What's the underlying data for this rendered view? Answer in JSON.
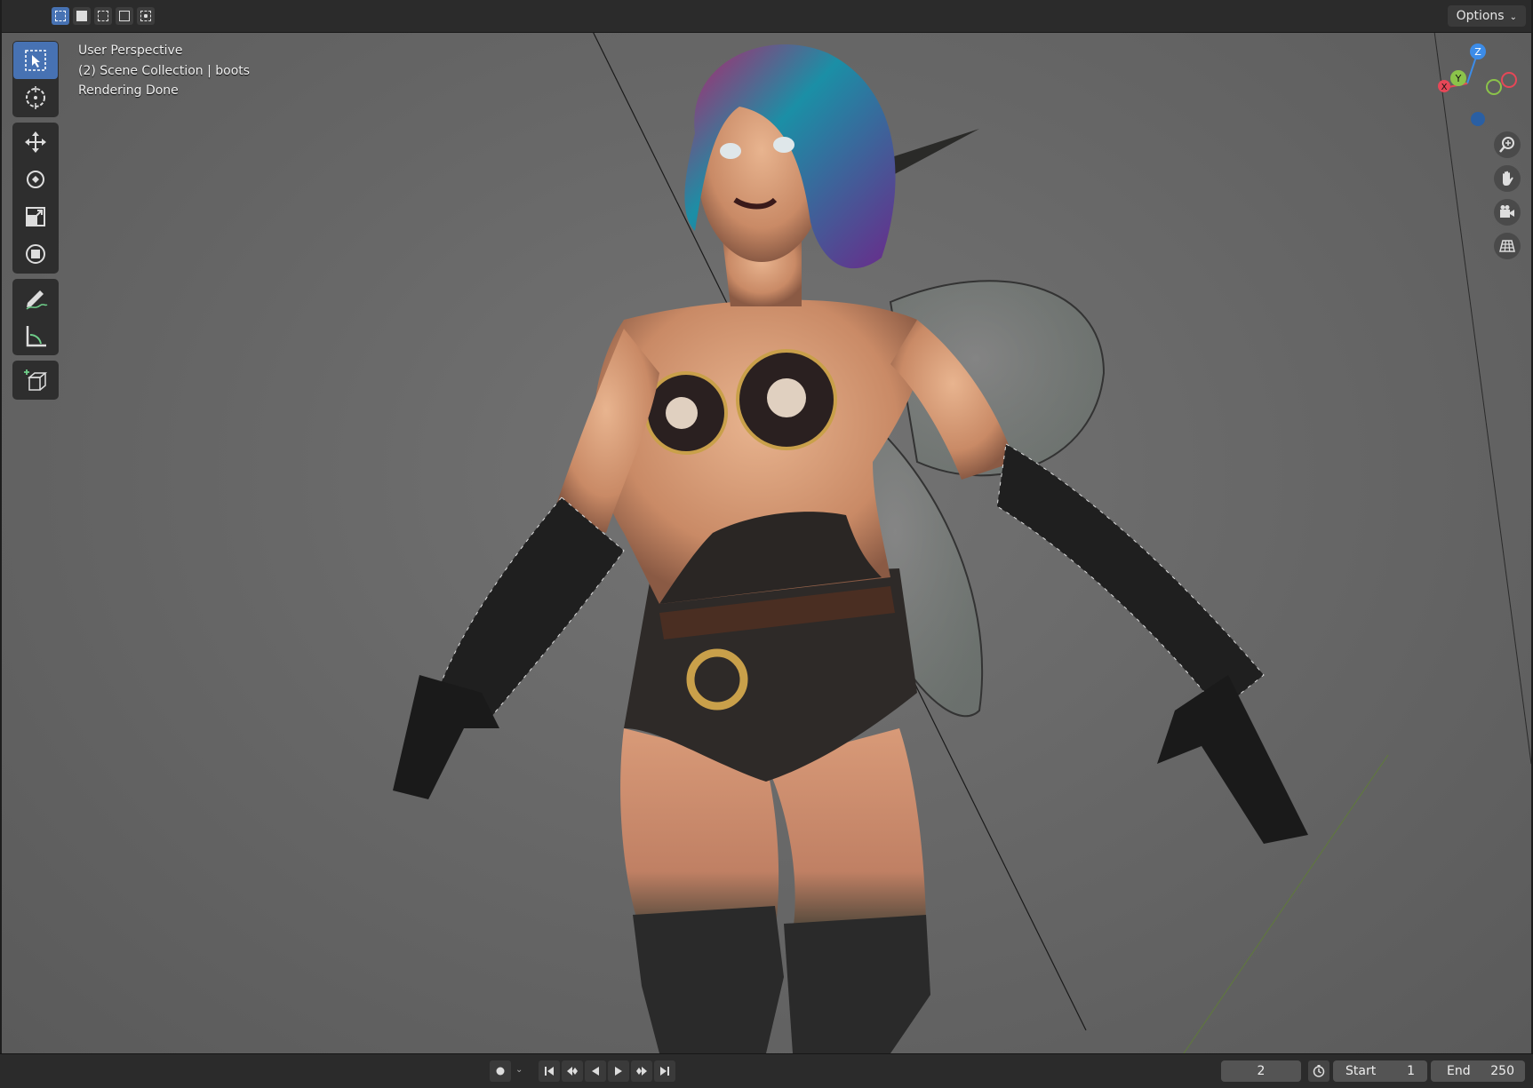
{
  "header": {
    "options_label": "Options",
    "select_modes": [
      "mode-set",
      "mode-extend",
      "mode-subtract",
      "mode-difference",
      "mode-intersect"
    ]
  },
  "toolbar": {
    "tools": [
      "select-box",
      "cursor",
      "move",
      "rotate",
      "scale",
      "transform",
      "annotate",
      "measure",
      "add-cube"
    ]
  },
  "viewport": {
    "line1": "User Perspective",
    "line2": "(2) Scene Collection | boots",
    "line3": "Rendering Done"
  },
  "gizmo": {
    "z": "Z",
    "y": "Y",
    "x": "X",
    "colors": {
      "x": "#e64757",
      "y": "#8bc34a",
      "z": "#3c8ce8",
      "neg_x": "#a8323f",
      "neg_y": "#6a9137",
      "neg_z": "#2a5fa3"
    }
  },
  "nav": [
    "zoom-icon",
    "hand-icon",
    "camera-icon",
    "grid-icon"
  ],
  "timeline": {
    "current_frame": "2",
    "start_label": "Start",
    "start_value": "1",
    "end_label": "End",
    "end_value": "250"
  }
}
